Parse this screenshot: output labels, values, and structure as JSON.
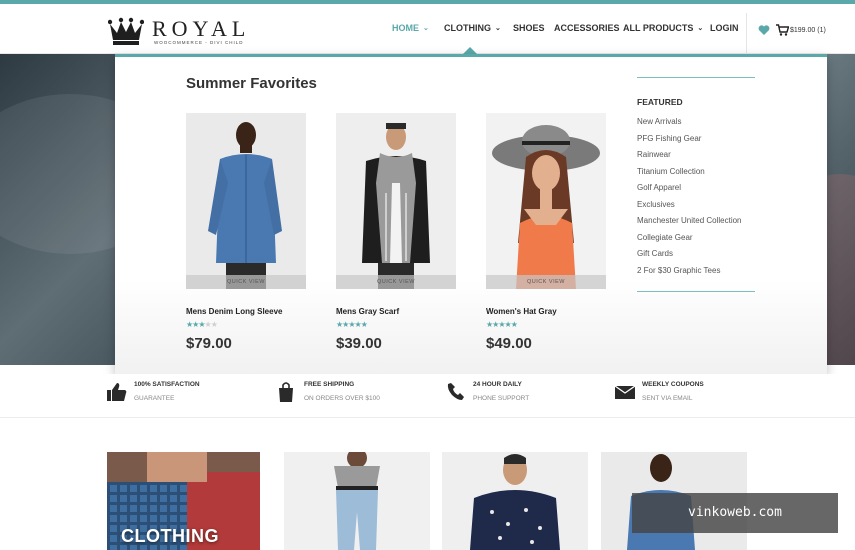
{
  "header": {
    "logo": {
      "name": "ROYAL",
      "tagline": "WOOCOMMERCE - DIVI CHILD"
    },
    "nav": [
      {
        "label": "HOME",
        "active": true,
        "dropdown": true
      },
      {
        "label": "CLOTHING",
        "active": false,
        "dropdown": true
      },
      {
        "label": "SHOES",
        "active": false,
        "dropdown": false
      },
      {
        "label": "ACCESSORIES",
        "active": false,
        "dropdown": false
      },
      {
        "label": "ALL PRODUCTS",
        "active": false,
        "dropdown": true
      },
      {
        "label": "LOGIN",
        "active": false,
        "dropdown": false
      }
    ],
    "cart_text": "$199.00 (1)",
    "icons": {
      "wishlist": "heart-icon",
      "cart": "cart-icon"
    }
  },
  "mega_menu": {
    "title": "Summer Favorites",
    "quick_view_label": "QUICK VIEW",
    "products": [
      {
        "name": "Mens Denim Long Sleeve",
        "rating": 3,
        "price": "$79.00"
      },
      {
        "name": "Mens Gray Scarf",
        "rating": 5,
        "price": "$39.00"
      },
      {
        "name": "Women's Hat Gray",
        "rating": 5,
        "price": "$49.00"
      }
    ],
    "featured": {
      "title": "FEATURED",
      "links": [
        "New Arrivals",
        "PFG Fishing Gear",
        "Rainwear",
        "Titanium Collection",
        "Golf Apparel",
        "Exclusives",
        "Manchester United Collection",
        "Collegiate Gear",
        "Gift Cards",
        "2 For $30 Graphic Tees"
      ]
    }
  },
  "features": [
    {
      "icon": "thumbs-up-icon",
      "title": "100% SATISFACTION",
      "subtitle": "GUARANTEE"
    },
    {
      "icon": "shopping-bag-icon",
      "title": "FREE SHIPPING",
      "subtitle": "ON ORDERS OVER $100"
    },
    {
      "icon": "phone-icon",
      "title": "24 HOUR DAILY",
      "subtitle": "PHONE SUPPORT"
    },
    {
      "icon": "envelope-icon",
      "title": "WEEKLY COUPONS",
      "subtitle": "SENT VIA EMAIL"
    }
  ],
  "categories": [
    {
      "label": "CLOTHING"
    },
    {
      "label": ""
    },
    {
      "label": ""
    },
    {
      "label": ""
    }
  ],
  "watermark": "vinkoweb.com",
  "colors": {
    "accent": "#5aa8aa",
    "text": "#333333"
  }
}
